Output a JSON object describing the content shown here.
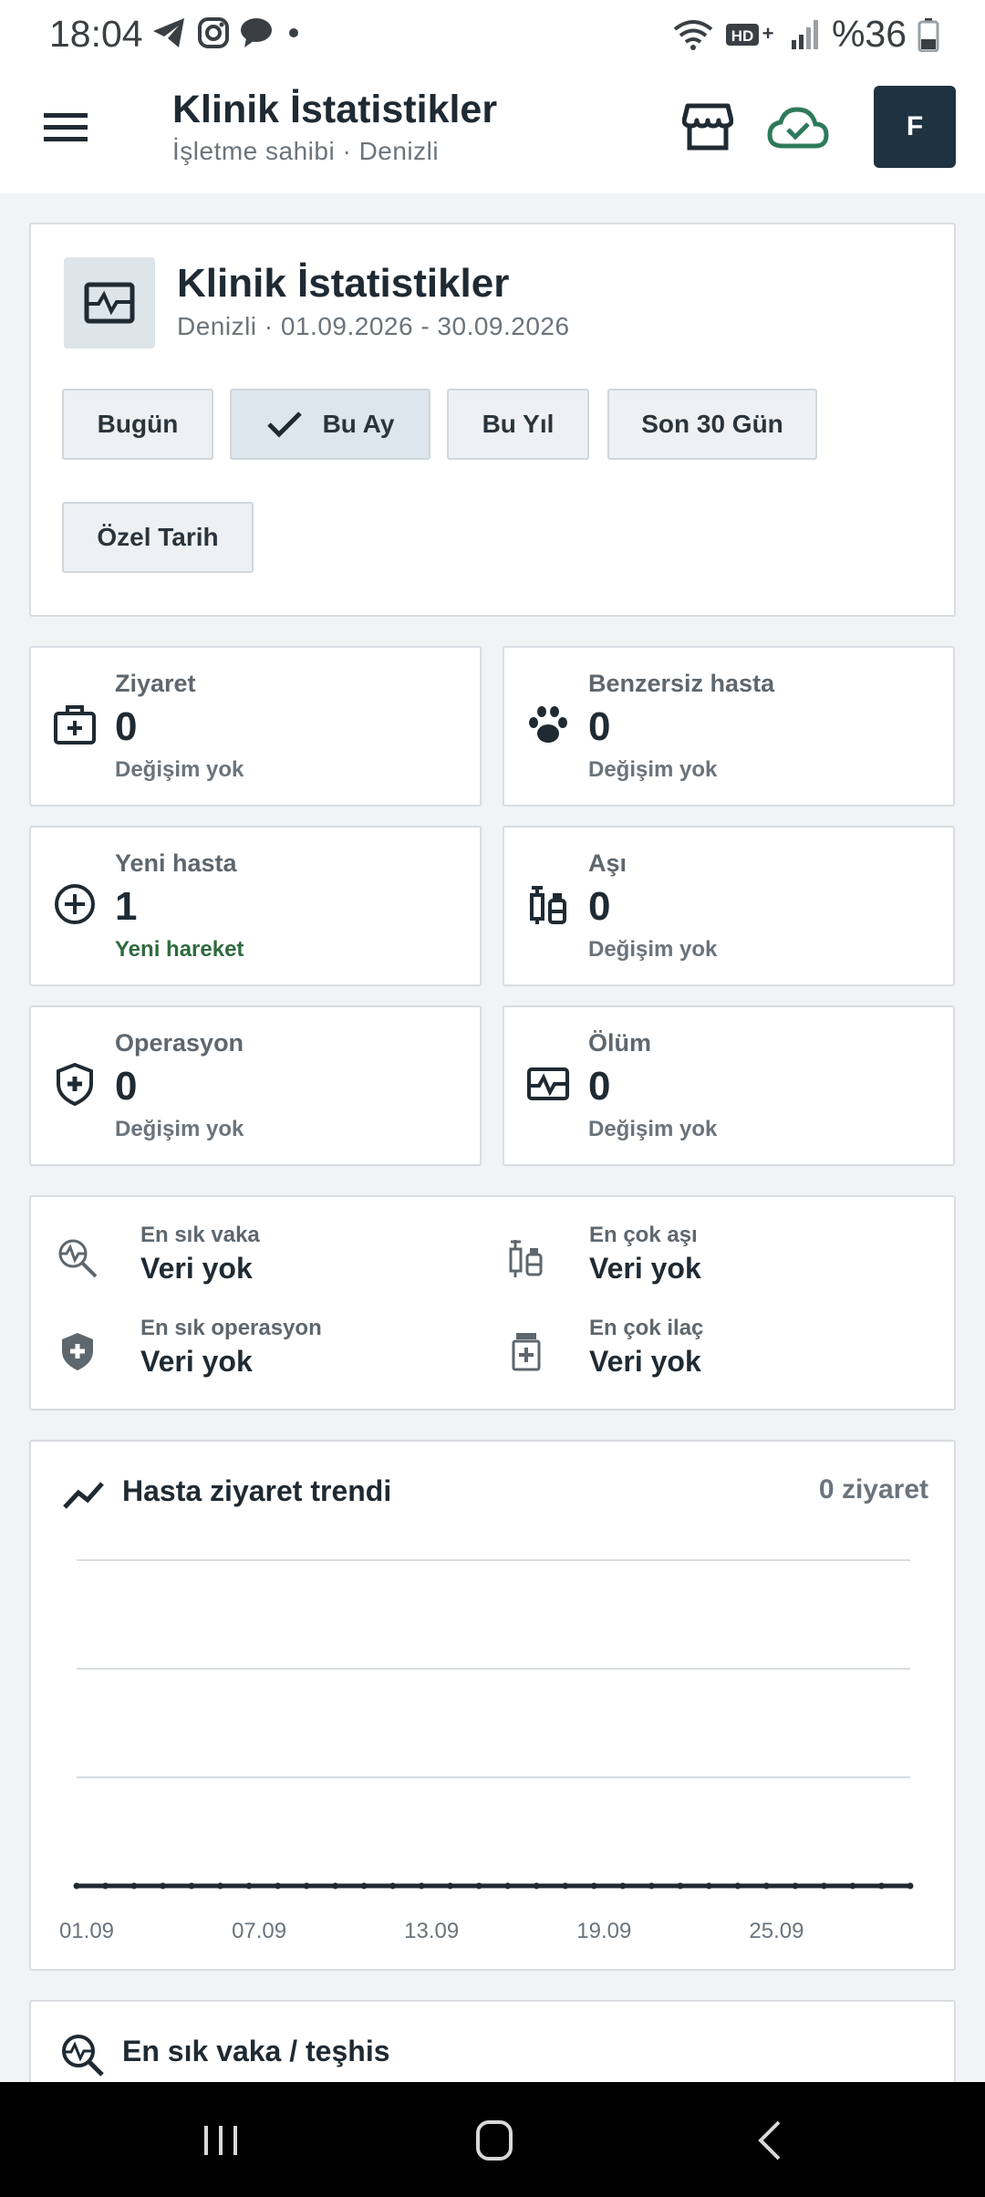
{
  "status_bar": {
    "time": "18:04",
    "battery": "%36"
  },
  "app_bar": {
    "title": "Klinik İstatistikler",
    "subtitle": "İşletme sahibi · Denizli",
    "avatar_initial": "F"
  },
  "header": {
    "title": "Klinik İstatistikler",
    "subtitle": "Denizli · 01.09.2026 - 30.09.2026",
    "filters": [
      {
        "label": "Bugün",
        "active": false
      },
      {
        "label": "Bu Ay",
        "active": true
      },
      {
        "label": "Bu Yıl",
        "active": false
      },
      {
        "label": "Son 30 Gün",
        "active": false
      },
      {
        "label": "Özel Tarih",
        "active": false
      }
    ]
  },
  "stats": [
    {
      "label": "Ziyaret",
      "value": "0",
      "change": "Değişim yok",
      "icon": "medical-kit-icon"
    },
    {
      "label": "Benzersiz hasta",
      "value": "0",
      "change": "Değişim yok",
      "icon": "paw-icon"
    },
    {
      "label": "Yeni hasta",
      "value": "1",
      "change": "Yeni hareket",
      "icon": "plus-circle-icon"
    },
    {
      "label": "Aşı",
      "value": "0",
      "change": "Değişim yok",
      "icon": "vaccine-icon"
    },
    {
      "label": "Operasyon",
      "value": "0",
      "change": "Değişim yok",
      "icon": "shield-plus-icon"
    },
    {
      "label": "Ölüm",
      "value": "0",
      "change": "Değişim yok",
      "icon": "monitor-heart-icon"
    }
  ],
  "summary": [
    {
      "label": "En sık vaka",
      "value": "Veri yok",
      "icon": "search-pulse-icon"
    },
    {
      "label": "En çok aşı",
      "value": "Veri yok",
      "icon": "vaccine-icon"
    },
    {
      "label": "En sık operasyon",
      "value": "Veri yok",
      "icon": "shield-plus-icon"
    },
    {
      "label": "En çok ilaç",
      "value": "Veri yok",
      "icon": "medicine-icon"
    }
  ],
  "trend": {
    "title": "Hasta ziyaret trendi",
    "count_label": "0 ziyaret"
  },
  "chart_data": {
    "type": "line",
    "title": "Hasta ziyaret trendi",
    "x": [
      "01.09",
      "02.09",
      "03.09",
      "04.09",
      "05.09",
      "06.09",
      "07.09",
      "08.09",
      "09.09",
      "10.09",
      "11.09",
      "12.09",
      "13.09",
      "14.09",
      "15.09",
      "16.09",
      "17.09",
      "18.09",
      "19.09",
      "20.09",
      "21.09",
      "22.09",
      "23.09",
      "24.09",
      "25.09",
      "26.09",
      "27.09",
      "28.09",
      "29.09",
      "30.09"
    ],
    "x_tick_labels": [
      "01.09",
      "07.09",
      "13.09",
      "19.09",
      "25.09"
    ],
    "series": [
      {
        "values": [
          0,
          0,
          0,
          0,
          0,
          0,
          0,
          0,
          0,
          0,
          0,
          0,
          0,
          0,
          0,
          0,
          0,
          0,
          0,
          0,
          0,
          0,
          0,
          0,
          0,
          0,
          0,
          0,
          0,
          0
        ]
      }
    ],
    "ylim": [
      0,
      3
    ],
    "grid": true,
    "color": "#1f2a33"
  },
  "next_section": {
    "title": "En sık vaka / teşhis"
  }
}
